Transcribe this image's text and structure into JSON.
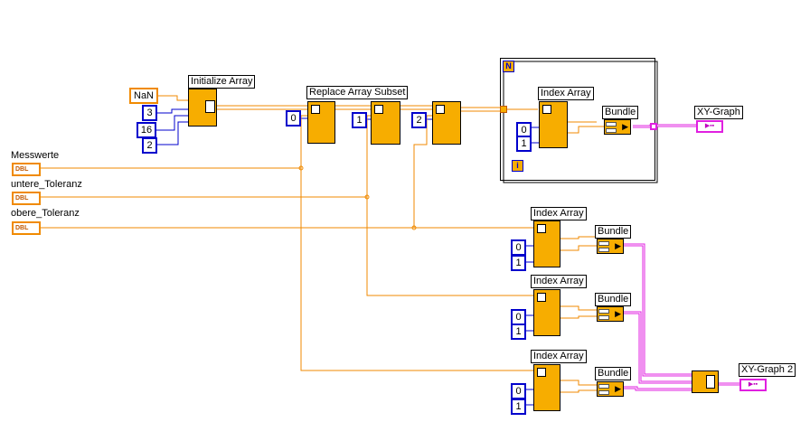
{
  "initialize_array": {
    "label": "Initialize Array"
  },
  "nan_constant": "NaN",
  "dims": [
    "3",
    "16",
    "2"
  ],
  "replace_array_subset": {
    "label": "Replace Array Subset"
  },
  "replace_indices": [
    "0",
    "1",
    "2"
  ],
  "inputs": [
    {
      "label": "Messwerte",
      "type": "DBL"
    },
    {
      "label": "untere_Toleranz",
      "type": "DBL"
    },
    {
      "label": "obere_Toleranz",
      "type": "DBL"
    }
  ],
  "for_loop": {
    "count_terminal": "N",
    "iteration_terminal": "i"
  },
  "index_array": {
    "label": "Index Array"
  },
  "index_constants": [
    "0",
    "1"
  ],
  "bundle": {
    "label": "Bundle"
  },
  "graphs": [
    {
      "label": "XY-Graph"
    },
    {
      "label": "XY-Graph 2"
    }
  ],
  "colors": {
    "orange_wire": "#f08a00",
    "pink_wire": "#e020e0",
    "node_fill": "#f7ad00",
    "const_border": "#0000cc"
  }
}
